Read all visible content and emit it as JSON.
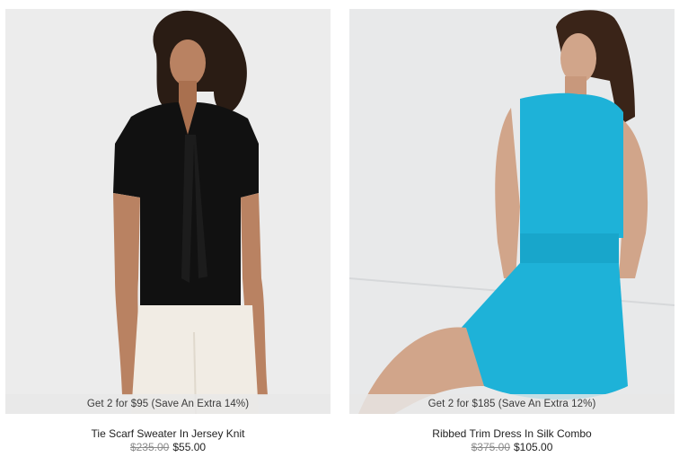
{
  "products": [
    {
      "image_alt": "Tie Scarf Sweater In Jersey Knit",
      "promo": "Get 2 for $95 (Save An Extra 14%)",
      "title": "Tie Scarf Sweater In Jersey Knit",
      "original_price": "$235.00",
      "sale_price": "$55.00"
    },
    {
      "image_alt": "Ribbed Trim Dress In Silk Combo",
      "promo": "Get 2 for $185 (Save An Extra 12%)",
      "title": "Ribbed Trim Dress In Silk Combo",
      "original_price": "$375.00",
      "sale_price": "$105.00"
    }
  ],
  "colors": {
    "sweater": "#111111",
    "pants": "#f1ece4",
    "dress": "#1eb2d8",
    "skin": "#b98262",
    "hair": "#2a1c14"
  }
}
